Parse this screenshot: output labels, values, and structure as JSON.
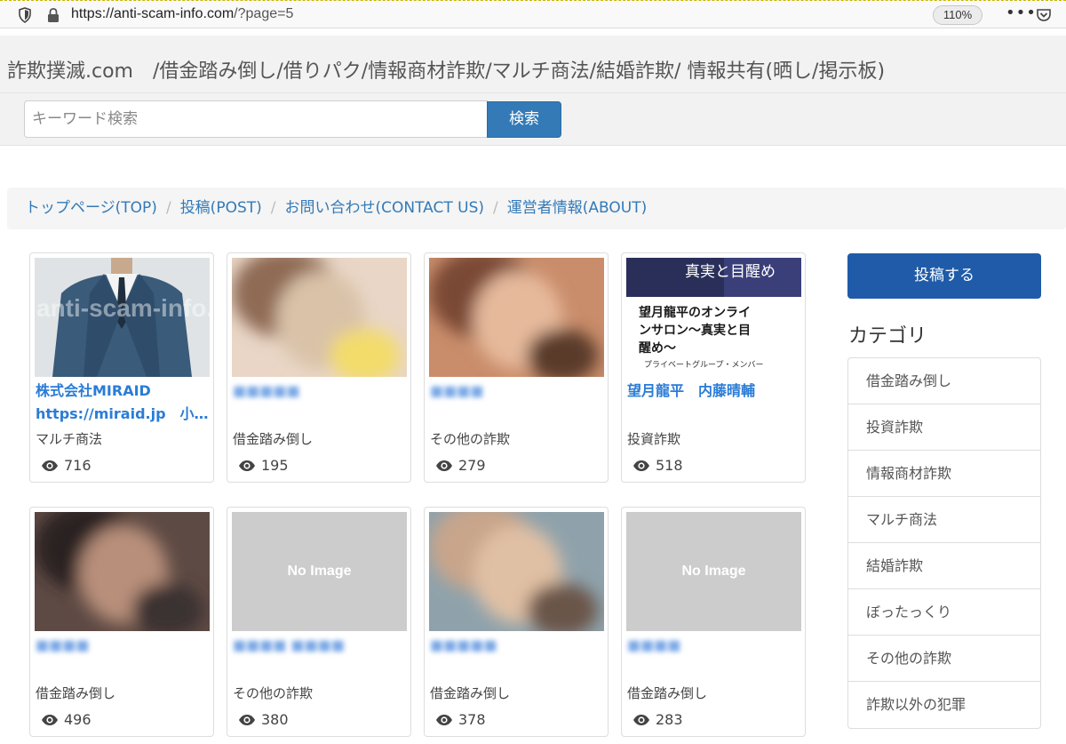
{
  "browser": {
    "url_host": "https://anti-scam-info.com",
    "url_path": "/?page=5",
    "zoom": "110%"
  },
  "header": {
    "site_title": "詐欺撲滅.com　/借金踏み倒し/借りパク/情報商材詐欺/マルチ商法/結婚詐欺/ 情報共有(晒し/掲示板)",
    "search_placeholder": "キーワード検索",
    "search_button": "検索"
  },
  "breadcrumb": [
    {
      "label": "トップページ(TOP)"
    },
    {
      "label": "投稿(POST)"
    },
    {
      "label": "お問い合わせ(CONTACT US)"
    },
    {
      "label": "運営者情報(ABOUT)"
    }
  ],
  "cards": [
    {
      "title_lines": [
        "株式会社MIRAID",
        "https://miraid.jp　小…"
      ],
      "category": "マルチ商法",
      "views": "716",
      "thumb": "suit",
      "blurred_title": false
    },
    {
      "title_lines": [
        "■■■■■"
      ],
      "category": "借金踏み倒し",
      "views": "195",
      "thumb": "blur-face",
      "blurred_title": true
    },
    {
      "title_lines": [
        "■■■■"
      ],
      "category": "その他の詐欺",
      "views": "279",
      "thumb": "blur-face2",
      "blurred_title": true
    },
    {
      "title_lines": [
        "望月龍平　内藤晴輔"
      ],
      "category": "投資詐欺",
      "views": "518",
      "thumb": "salon",
      "blurred_title": false
    },
    {
      "title_lines": [
        "■■■■"
      ],
      "category": "借金踏み倒し",
      "views": "496",
      "thumb": "blur-dark",
      "blurred_title": true
    },
    {
      "title_lines": [
        "■■■■ ■■■■"
      ],
      "category": "その他の詐欺",
      "views": "380",
      "thumb": "noimage",
      "blurred_title": true
    },
    {
      "title_lines": [
        "■■■■■"
      ],
      "category": "借金踏み倒し",
      "views": "378",
      "thumb": "blur-face3",
      "blurred_title": true
    },
    {
      "title_lines": [
        "■■■■"
      ],
      "category": "借金踏み倒し",
      "views": "283",
      "thumb": "noimage",
      "blurred_title": true
    }
  ],
  "thumb_text": {
    "watermark": "anti-scam-info.com",
    "salon_banner": "真実と目醒め",
    "salon_main": "望月龍平のオンラインサロン〜真実と目醒め〜",
    "salon_sub": "プライベートグループ・メンバー",
    "no_image": "No Image"
  },
  "sidebar": {
    "post_button": "投稿する",
    "category_heading": "カテゴリ",
    "categories": [
      "借金踏み倒し",
      "投資詐欺",
      "情報商材詐欺",
      "マルチ商法",
      "結婚詐欺",
      "ぼったっくり",
      "その他の詐欺",
      "詐欺以外の犯罪"
    ]
  },
  "colors": {
    "link": "#337ab7",
    "card_title": "#2a7cd6",
    "post_button": "#1f5ba8"
  }
}
